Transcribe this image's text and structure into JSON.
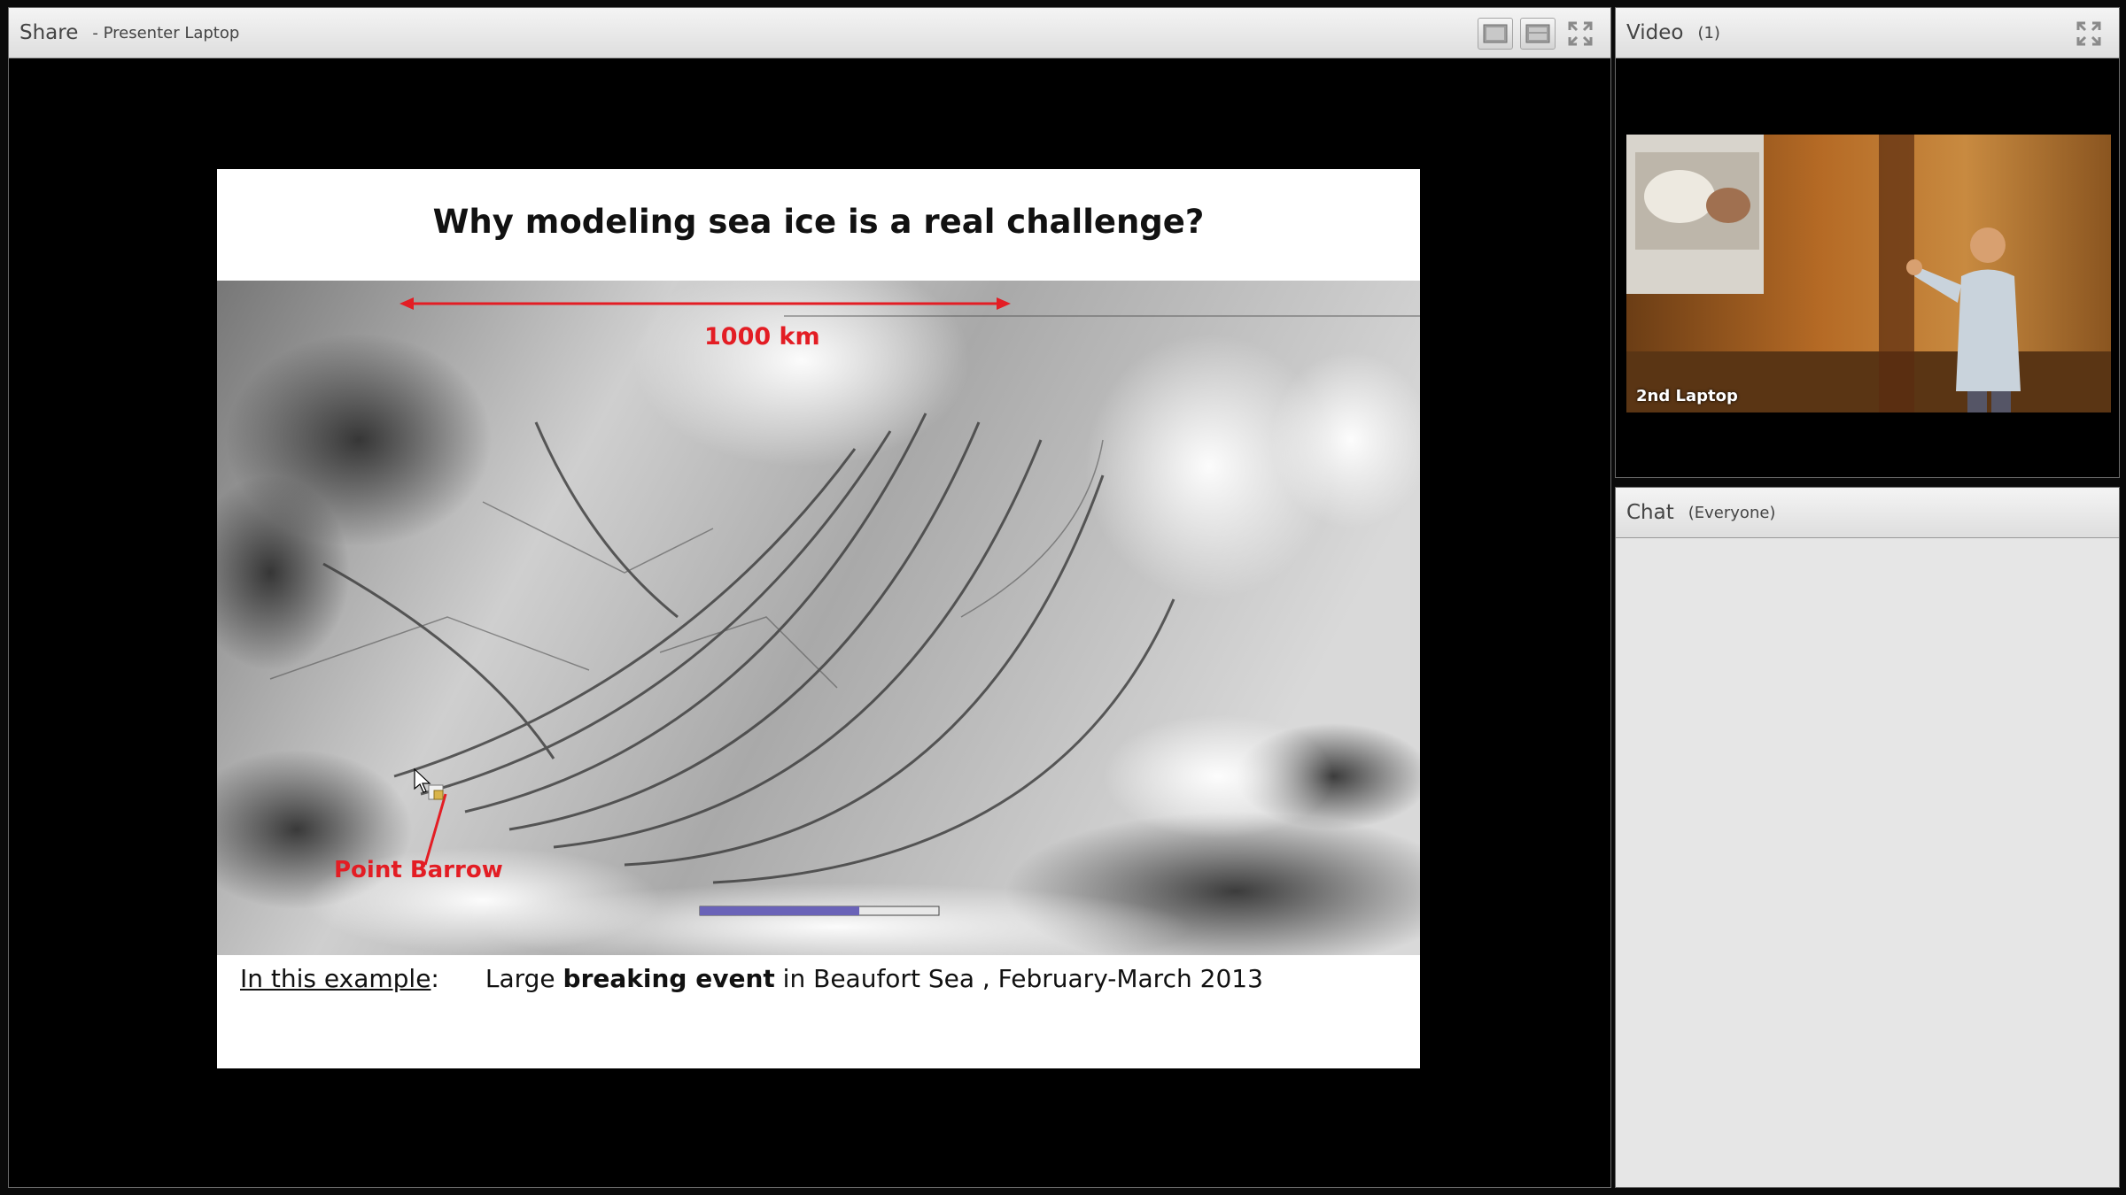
{
  "share_pod": {
    "title": "Share",
    "subtitle": "- Presenter Laptop",
    "tools": [
      "layout-single-icon",
      "layout-split-icon",
      "fullscreen-icon"
    ]
  },
  "slide": {
    "title": "Why modeling sea ice is a real challenge?",
    "scale_label": "1000 km",
    "point_label": "Point Barrow",
    "caption": {
      "lead": "In this example",
      "colon": ":",
      "pre": "Large ",
      "bold": "breaking event",
      "post": " in Beaufort Sea , February-March 2013"
    },
    "colors": {
      "annotation": "#e31d24"
    }
  },
  "video_pod": {
    "title": "Video",
    "count": "(1)",
    "feed_label": "2nd Laptop",
    "fullscreen_icon": "fullscreen-icon"
  },
  "chat_pod": {
    "title": "Chat",
    "audience": "(Everyone)"
  }
}
